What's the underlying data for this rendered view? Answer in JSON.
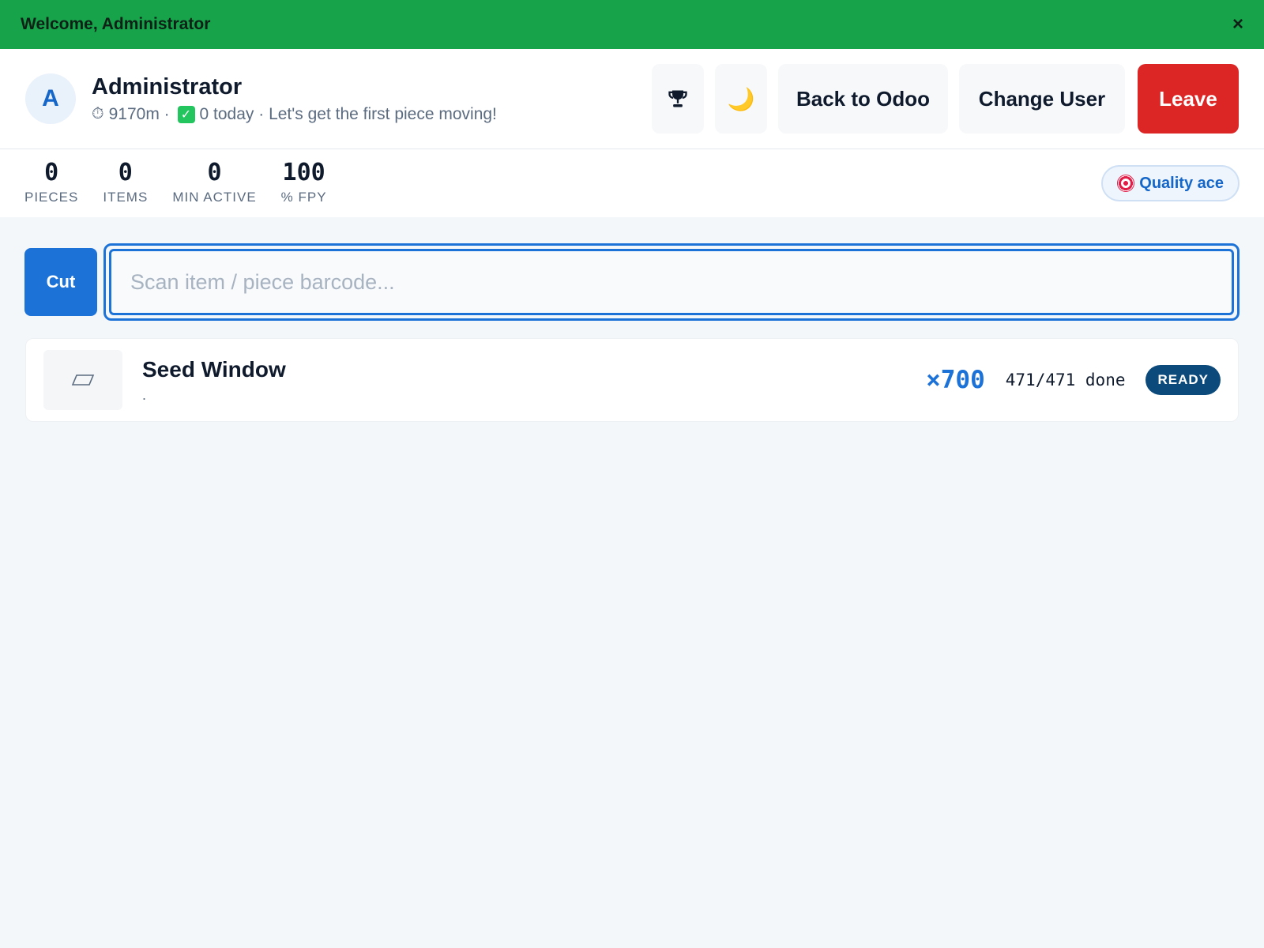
{
  "banner": {
    "text": "Welcome, Administrator",
    "close_label": "×",
    "color": "#16a34a"
  },
  "header": {
    "avatar_letter": "A",
    "user_name": "Administrator",
    "stopwatch_icon": "⏱",
    "minutes": "9170m",
    "separator1": " · ",
    "check_icon": "✓",
    "today": "0 today",
    "separator2": " · ",
    "message": "Let's get the first piece moving!",
    "trophy_icon": "trophy-icon",
    "moon_glyph": "🌙",
    "back_label": "Back to Odoo",
    "change_user_label": "Change User",
    "leave_label": "Leave",
    "leave_color": "#dc2626"
  },
  "stats": {
    "items": [
      {
        "value": "0",
        "label": "PIECES"
      },
      {
        "value": "0",
        "label": "ITEMS"
      },
      {
        "value": "0",
        "label": "MIN ACTIVE"
      },
      {
        "value": "100",
        "label": "% FPY"
      }
    ],
    "badge": "Quality ace"
  },
  "scan": {
    "mode_label": "Cut",
    "placeholder": "Scan item / piece barcode...",
    "value": "",
    "accent": "#1d72d8"
  },
  "items": [
    {
      "title": "Seed Window",
      "subtitle": ".",
      "quantity": "×700",
      "progress": "471/471 done",
      "status": "READY"
    }
  ]
}
